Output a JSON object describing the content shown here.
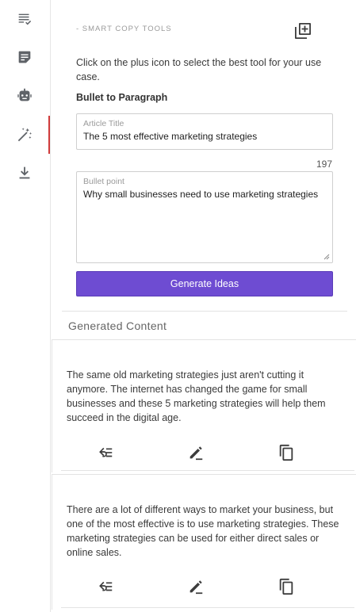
{
  "sidebar": {
    "items": [
      {
        "icon": "list-check-icon"
      },
      {
        "icon": "note-icon"
      },
      {
        "icon": "robot-icon"
      },
      {
        "icon": "magic-wand-icon",
        "active": true
      },
      {
        "icon": "download-icon"
      }
    ]
  },
  "header": {
    "label": "- SMART COPY TOOLS",
    "add_icon": "add-box-icon"
  },
  "instructions": "Click on the plus icon to select the best tool for your use case.",
  "tool_name": "Bullet to Paragraph",
  "form": {
    "title_label": "Article Title",
    "title_value": "The 5 most effective marketing strategies",
    "char_counter": "197",
    "bullet_label": "Bullet point",
    "bullet_value": "Why small businesses need to use marketing strategies",
    "generate_label": "Generate Ideas"
  },
  "generated": {
    "title": "Generated Content",
    "cards": [
      {
        "text": "The same old marketing strategies just aren't cutting it anymore. The internet has changed the game for small businesses and these 5 marketing strategies will help them succeed in the digital age."
      },
      {
        "text": "There are a lot of different ways to market your business, but one of the most effective is to use marketing strategies. These marketing strategies can be used for either direct sales or online sales."
      }
    ]
  },
  "colors": {
    "accent": "#6e4cd2",
    "active_indicator": "#d13b3b"
  }
}
